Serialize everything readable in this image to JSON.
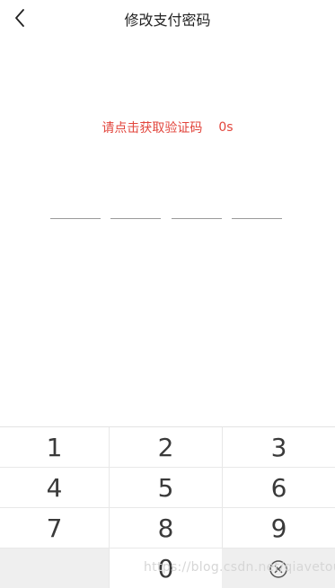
{
  "header": {
    "title": "修改支付密码",
    "back_icon": "chevron-left-icon"
  },
  "verification": {
    "prompt": "请点击获取验证码",
    "countdown": "0s",
    "accent_color": "#e2453c"
  },
  "code_slots": [
    "",
    "",
    "",
    ""
  ],
  "keypad": {
    "rows": [
      [
        "1",
        "2",
        "3"
      ],
      [
        "4",
        "5",
        "6"
      ],
      [
        "7",
        "8",
        "9"
      ],
      [
        "",
        "0",
        ""
      ]
    ],
    "delete_icon": "backspace-circle-x-icon"
  },
  "watermark": "https://blog.csdn.net/qiavetou"
}
